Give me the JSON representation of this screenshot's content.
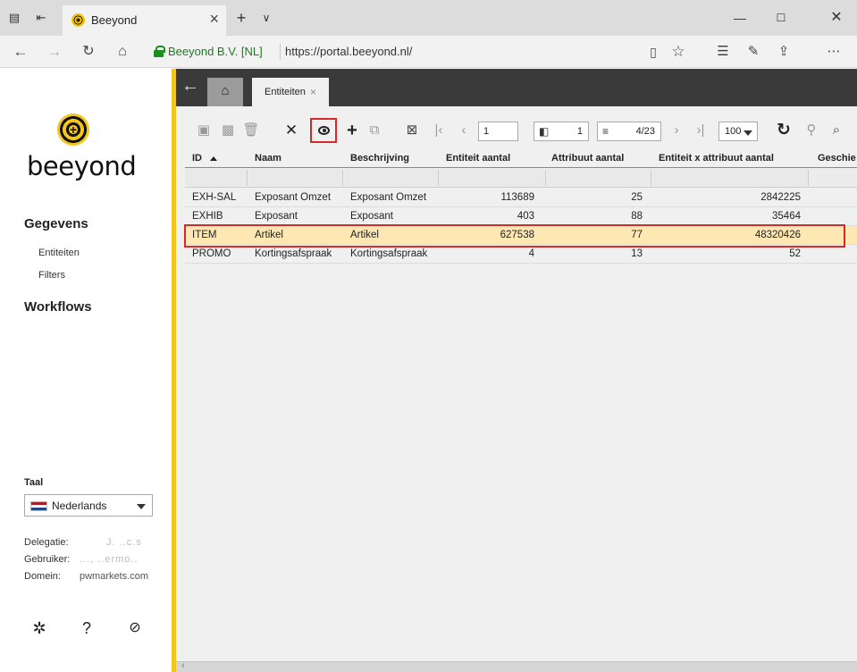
{
  "browser": {
    "tab_title": "Beeyond",
    "site_identity": "Beeyond B.V. [NL]",
    "url": "https://portal.beeyond.nl/"
  },
  "sidebar": {
    "logo_text": "beeyond",
    "section_data": "Gegevens",
    "links": [
      "Entiteiten",
      "Filters"
    ],
    "section_workflows": "Workflows",
    "language_label": "Taal",
    "language_value": "Nederlands",
    "info": [
      {
        "label": "Delegatie:",
        "value": "J. ..c.s"
      },
      {
        "label": "Gebruiker:",
        "value": "..., ..ermo.."
      },
      {
        "label": "Domein:",
        "value": "pwmarkets.com"
      }
    ]
  },
  "app": {
    "tab_label": "Entiteiten",
    "toolbar": {
      "page_value": "1",
      "selected_count": "1",
      "record_position": "4/23",
      "page_size": "100"
    },
    "table": {
      "columns": [
        "ID",
        "Naam",
        "Beschrijving",
        "Entiteit aantal",
        "Attribuut aantal",
        "Entiteit x attribuut aantal",
        "Geschie"
      ],
      "rows": [
        [
          "EXH-SAL",
          "Exposant Omzet",
          "Exposant Omzet",
          "113689",
          "25",
          "2842225"
        ],
        [
          "EXHIB",
          "Exposant",
          "Exposant",
          "403",
          "88",
          "35464"
        ],
        [
          "ITEM",
          "Artikel",
          "Artikel",
          "627538",
          "77",
          "48320426"
        ],
        [
          "PROMO",
          "Kortingsafspraak",
          "Kortingsafspraak",
          "4",
          "13",
          "52"
        ]
      ],
      "selected_row": 2
    }
  },
  "colors": {
    "accent_yellow": "#f4c51a",
    "selected_row": "#fde8b4",
    "highlight_red": "#d62a2a",
    "topbar_dark": "#3a3a3a"
  }
}
